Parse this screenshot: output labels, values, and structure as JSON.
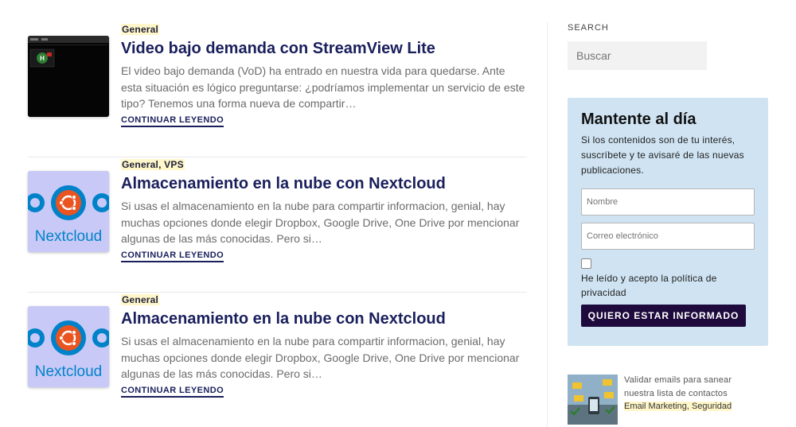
{
  "posts": [
    {
      "categories": "General",
      "title": "Video bajo demanda con StreamView Lite",
      "excerpt": "El video bajo demanda (VoD) ha entrado en nuestra vida para quedarse. Ante esta situación es lógico preguntarse: ¿podríamos implementar un servicio de este tipo? Tenemos una forma nueva de compartir…",
      "read_more": "CONTINUAR LEYENDO",
      "thumb": "streamview-screenshot"
    },
    {
      "categories": "General, VPS",
      "title": "Almacenamiento en la nube con Nextcloud",
      "excerpt": "Si usas el almacenamiento en la nube para compartir informacion, genial, hay muchas opciones donde elegir Dropbox, Google Drive, One Drive por mencionar algunas de las más conocidas. Pero si…",
      "read_more": "CONTINUAR LEYENDO",
      "thumb": "nextcloud-logo",
      "logo_text": "Nextcloud"
    },
    {
      "categories": "General",
      "title": "Almacenamiento en la nube con Nextcloud",
      "excerpt": "Si usas el almacenamiento en la nube para compartir informacion, genial, hay muchas opciones donde elegir Dropbox, Google Drive, One Drive por mencionar algunas de las más conocidas. Pero si…",
      "read_more": "CONTINUAR LEYENDO",
      "thumb": "nextcloud-logo",
      "logo_text": "Nextcloud"
    }
  ],
  "sidebar": {
    "search_label": "SEARCH",
    "search_placeholder": "Buscar",
    "newsletter": {
      "title": "Mantente al día",
      "text": "Si los contenidos son de tu interés, suscríbete y te avisaré de las nuevas publicaciones.",
      "name_placeholder": "Nombre",
      "email_placeholder": "Correo electrónico",
      "consent_prefix": "He leído y acepto la ",
      "consent_link": "política de privacidad",
      "button": "QUIERO ESTAR INFORMADO"
    },
    "related": {
      "title": "Validar emails para sanear nuestra lista de contactos",
      "categories": "Email Marketing, Seguridad"
    }
  },
  "colors": {
    "title": "#1a1f5c",
    "newsletter_bg": "#cfe3f2",
    "button_bg": "#1e0a3c",
    "nextcloud_blue": "#0082c9",
    "ubuntu_orange": "#e95420"
  }
}
